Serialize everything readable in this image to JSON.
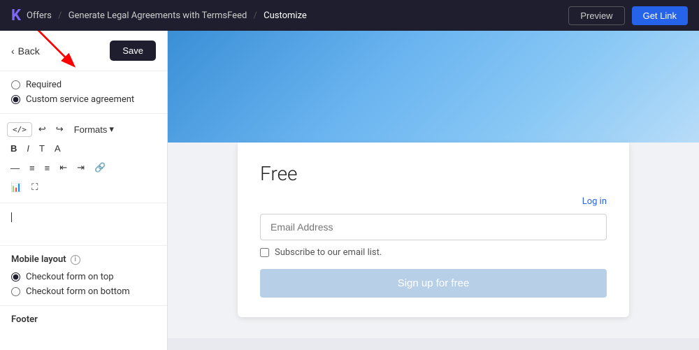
{
  "topnav": {
    "logo": "K",
    "breadcrumb": {
      "part1": "Offers",
      "sep1": "/",
      "part2": "Generate Legal Agreements with TermsFeed",
      "sep2": "/",
      "part3": "Customize"
    },
    "preview_label": "Preview",
    "getlink_label": "Get Link"
  },
  "sidebar": {
    "back_label": "Back",
    "save_label": "Save",
    "options": {
      "required_label": "Required",
      "custom_label": "Custom service agreement"
    },
    "toolbar": {
      "code_label": "</>",
      "undo_label": "↩",
      "redo_label": "↪",
      "formats_label": "Formats",
      "chevron_label": "▾",
      "bold_label": "B",
      "italic_label": "I",
      "heading_label": "T",
      "color_label": "A",
      "hr_label": "—",
      "ul_label": "≡",
      "ol_label": "≡",
      "indent_left_label": "⇤",
      "indent_right_label": "⇥",
      "link_label": "🔗",
      "chart_label": "📊",
      "expand_label": "⛶"
    },
    "editor_placeholder": "|",
    "mobile_layout": {
      "title": "Mobile layout",
      "info_icon": "i",
      "option1": "Checkout form on top",
      "option2": "Checkout form on bottom"
    },
    "footer_title": "Footer"
  },
  "content": {
    "plan_title": "Free",
    "log_in": "Log in",
    "email_placeholder": "Email Address",
    "subscribe_label": "Subscribe to our email list.",
    "signup_label": "Sign up for free"
  }
}
